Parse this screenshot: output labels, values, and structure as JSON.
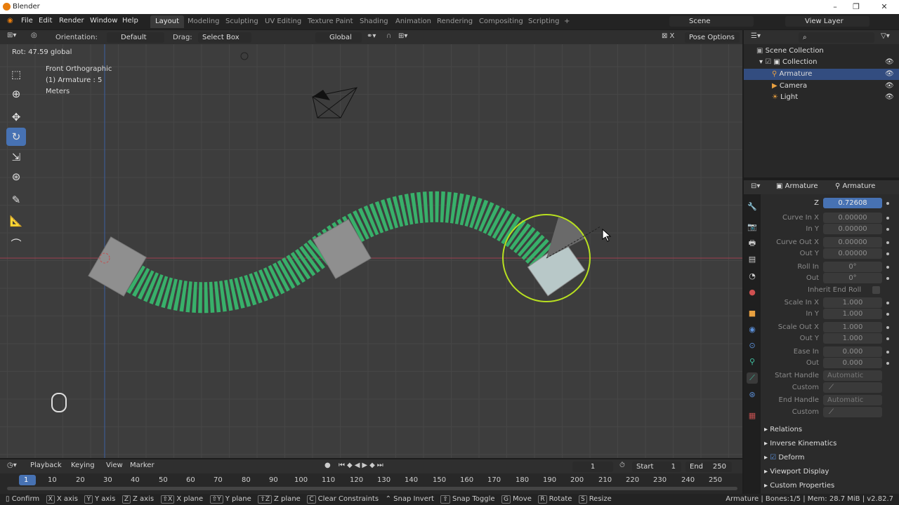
{
  "app": {
    "title": "Blender"
  },
  "menu": [
    "File",
    "Edit",
    "Render",
    "Window",
    "Help"
  ],
  "workspaces": [
    "Layout",
    "Modeling",
    "Sculpting",
    "UV Editing",
    "Texture Paint",
    "Shading",
    "Animation",
    "Rendering",
    "Compositing",
    "Scripting"
  ],
  "scene": "Scene",
  "view_layer": "View Layer",
  "header": {
    "orientation_label": "Orientation:",
    "orientation": "Default",
    "drag_label": "Drag:",
    "drag": "Select Box",
    "transform": "Global",
    "pose_options": "Pose Options"
  },
  "viewport": {
    "op_text": "Rot: 47.59 global",
    "view": "Front Orthographic",
    "object": "(1) Armature : 5",
    "units": "Meters"
  },
  "outliner": {
    "root": "Scene Collection",
    "collection": "Collection",
    "items": [
      "Armature",
      "Camera",
      "Light"
    ]
  },
  "props": {
    "tab1": "Armature",
    "tab2": "Armature",
    "fields": [
      {
        "label": "Z",
        "value": "0.72608"
      },
      {
        "label": "Curve In X",
        "value": "0.00000"
      },
      {
        "label": "In Y",
        "value": "0.00000"
      },
      {
        "label": "Curve Out X",
        "value": "0.00000"
      },
      {
        "label": "Out Y",
        "value": "0.00000"
      },
      {
        "label": "Roll In",
        "value": "0°"
      },
      {
        "label": "Out",
        "value": "0°"
      },
      {
        "label": "Inherit End Roll",
        "value": ""
      },
      {
        "label": "Scale In X",
        "value": "1.000"
      },
      {
        "label": "In Y",
        "value": "1.000"
      },
      {
        "label": "Scale Out X",
        "value": "1.000"
      },
      {
        "label": "Out Y",
        "value": "1.000"
      },
      {
        "label": "Ease In",
        "value": "0.000"
      },
      {
        "label": "Out",
        "value": "0.000"
      },
      {
        "label": "Start Handle",
        "value": "Automatic"
      },
      {
        "label": "Custom",
        "value": ""
      },
      {
        "label": "End Handle",
        "value": "Automatic"
      },
      {
        "label": "Custom",
        "value": ""
      }
    ],
    "panels": [
      "Relations",
      "Inverse Kinematics",
      "Deform",
      "Viewport Display",
      "Custom Properties"
    ]
  },
  "timeline": {
    "menus": [
      "Playback",
      "Keying",
      "View",
      "Marker"
    ],
    "current": "1",
    "start_label": "Start",
    "start": "1",
    "end_label": "End",
    "end": "250",
    "ticks": [
      "1",
      "10",
      "20",
      "30",
      "40",
      "50",
      "60",
      "70",
      "80",
      "90",
      "100",
      "110",
      "120",
      "130",
      "140",
      "150",
      "160",
      "170",
      "180",
      "190",
      "200",
      "210",
      "220",
      "230",
      "240",
      "250"
    ]
  },
  "status": {
    "items": [
      [
        "",
        "Confirm"
      ],
      [
        "X",
        "X axis"
      ],
      [
        "Y",
        "Y axis"
      ],
      [
        "Z",
        "Z axis"
      ],
      [
        "⇧X",
        "X plane"
      ],
      [
        "⇧Y",
        "Y plane"
      ],
      [
        "⇧Z",
        "Z plane"
      ],
      [
        "C",
        "Clear Constraints"
      ],
      [
        "",
        "Snap Invert"
      ],
      [
        "⇧",
        "Snap Toggle"
      ],
      [
        "G",
        "Move"
      ],
      [
        "R",
        "Rotate"
      ],
      [
        "S",
        "Resize"
      ]
    ],
    "info": "Armature | Bones:1/5 | Mem: 28.7 MiB | v2.82.7"
  }
}
